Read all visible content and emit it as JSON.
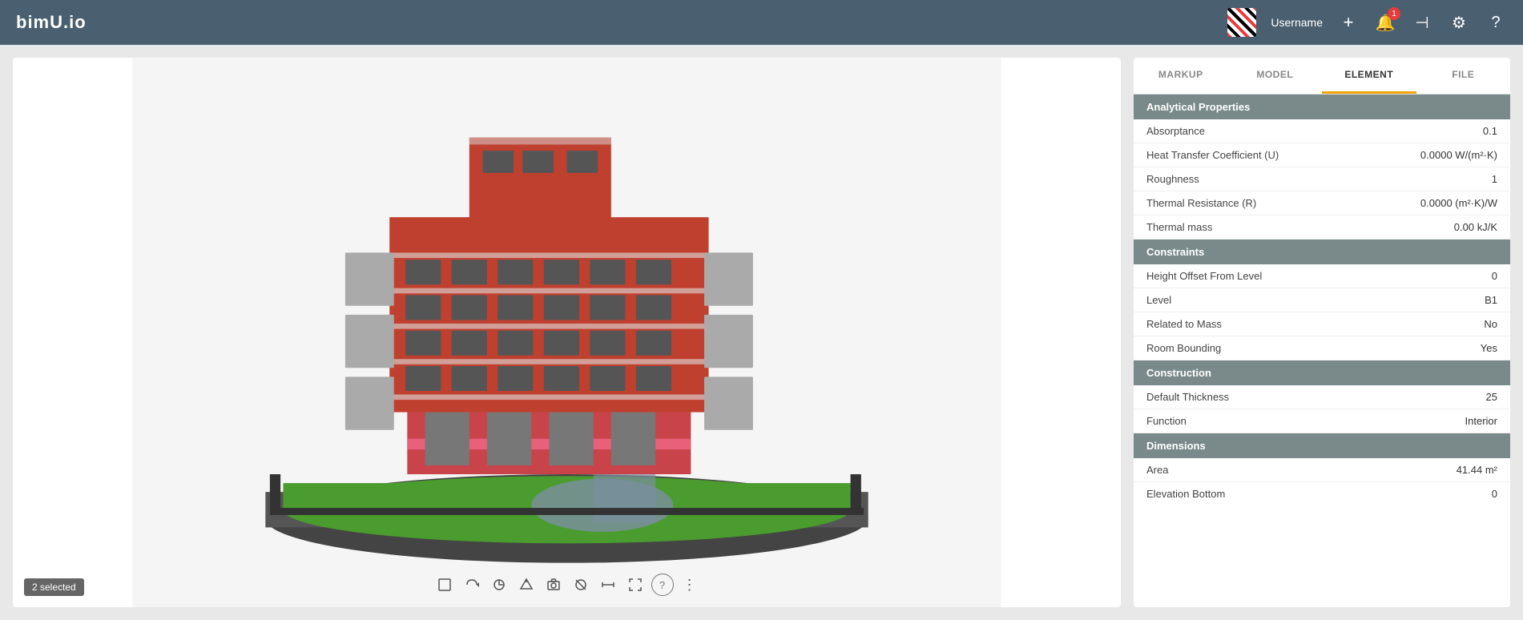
{
  "app": {
    "logo": "bimU.io",
    "username": "Username"
  },
  "nav": {
    "add_label": "+",
    "notification_count": "1"
  },
  "viewer": {
    "selected_label": "2 selected"
  },
  "toolbar_icons": [
    "⬜",
    "↩",
    "↻",
    "◈",
    "📷",
    "⊘",
    "⊢",
    "⬜",
    "?",
    "⋮"
  ],
  "properties": {
    "tabs": [
      {
        "id": "markup",
        "label": "MARKUP",
        "active": false
      },
      {
        "id": "model",
        "label": "MODEL",
        "active": false
      },
      {
        "id": "element",
        "label": "ELEMENT",
        "active": true
      },
      {
        "id": "file",
        "label": "FILE",
        "active": false
      }
    ],
    "sections": [
      {
        "title": "Analytical Properties",
        "rows": [
          {
            "label": "Absorptance",
            "value": "0.1"
          },
          {
            "label": "Heat Transfer Coefficient (U)",
            "value": "0.0000 W/(m²·K)"
          },
          {
            "label": "Roughness",
            "value": "1"
          },
          {
            "label": "Thermal Resistance (R)",
            "value": "0.0000 (m²·K)/W"
          },
          {
            "label": "Thermal mass",
            "value": "0.00 kJ/K"
          }
        ]
      },
      {
        "title": "Constraints",
        "rows": [
          {
            "label": "Height Offset From Level",
            "value": "0"
          },
          {
            "label": "Level",
            "value": "B1"
          },
          {
            "label": "Related to Mass",
            "value": "No"
          },
          {
            "label": "Room Bounding",
            "value": "Yes"
          }
        ]
      },
      {
        "title": "Construction",
        "rows": [
          {
            "label": "Default Thickness",
            "value": "25"
          },
          {
            "label": "Function",
            "value": "Interior"
          }
        ]
      },
      {
        "title": "Dimensions",
        "rows": [
          {
            "label": "Area",
            "value": "41.44 m²"
          },
          {
            "label": "Elevation Bottom",
            "value": "0"
          }
        ]
      }
    ]
  }
}
